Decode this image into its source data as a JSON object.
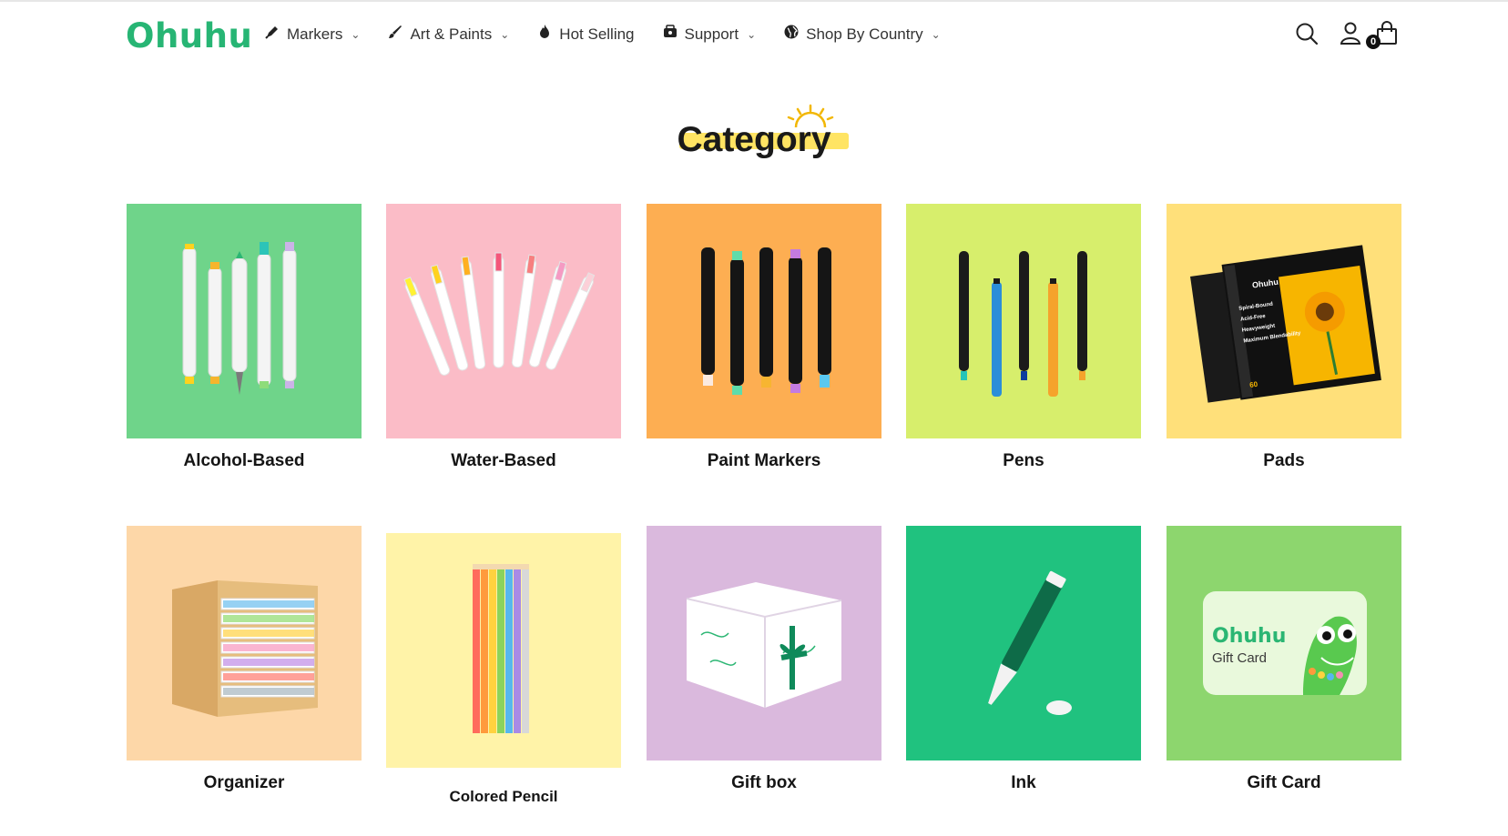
{
  "brand": {
    "logo_text": "Ohuhu",
    "accent_color": "#27b574"
  },
  "nav": {
    "items": [
      {
        "label": "Markers",
        "icon": "marker-icon",
        "has_dropdown": true
      },
      {
        "label": "Art & Paints",
        "icon": "brush-icon",
        "has_dropdown": true
      },
      {
        "label": "Hot Selling",
        "icon": "flame-icon",
        "has_dropdown": false
      },
      {
        "label": "Support",
        "icon": "support-icon",
        "has_dropdown": true
      },
      {
        "label": "Shop By Country",
        "icon": "globe-icon",
        "has_dropdown": true
      }
    ],
    "chevron": "⌄"
  },
  "header_icons": {
    "search": "search-icon",
    "account": "user-icon",
    "cart": "bag-icon",
    "cart_count": "0"
  },
  "section": {
    "title": "Category",
    "highlight_color": "#ffe463"
  },
  "categories": [
    {
      "label": "Alcohol-Based",
      "bg": "#6fd48a"
    },
    {
      "label": "Water-Based",
      "bg": "#fbbcc7"
    },
    {
      "label": "Paint Markers",
      "bg": "#fdae52"
    },
    {
      "label": "Pens",
      "bg": "#d7ee6c"
    },
    {
      "label": "Pads",
      "bg": "#ffe07a"
    },
    {
      "label": "Organizer",
      "bg": "#fdd7a8"
    },
    {
      "label": "Colored Pencil",
      "bg": "#fff3a8"
    },
    {
      "label": "Gift box",
      "bg": "#dab9dd"
    },
    {
      "label": "Ink",
      "bg": "#20c27f"
    },
    {
      "label": "Gift Card",
      "bg": "#8dd66e"
    }
  ],
  "gift_card": {
    "logo_text": "Ohuhu",
    "label": "Gift Card"
  },
  "pads_cover": {
    "brand": "Ohuhu",
    "lines": [
      "Spiral-Bound",
      "Acid-Free",
      "Heavyweight",
      "Maximum Blendability"
    ],
    "sheets": "60"
  }
}
